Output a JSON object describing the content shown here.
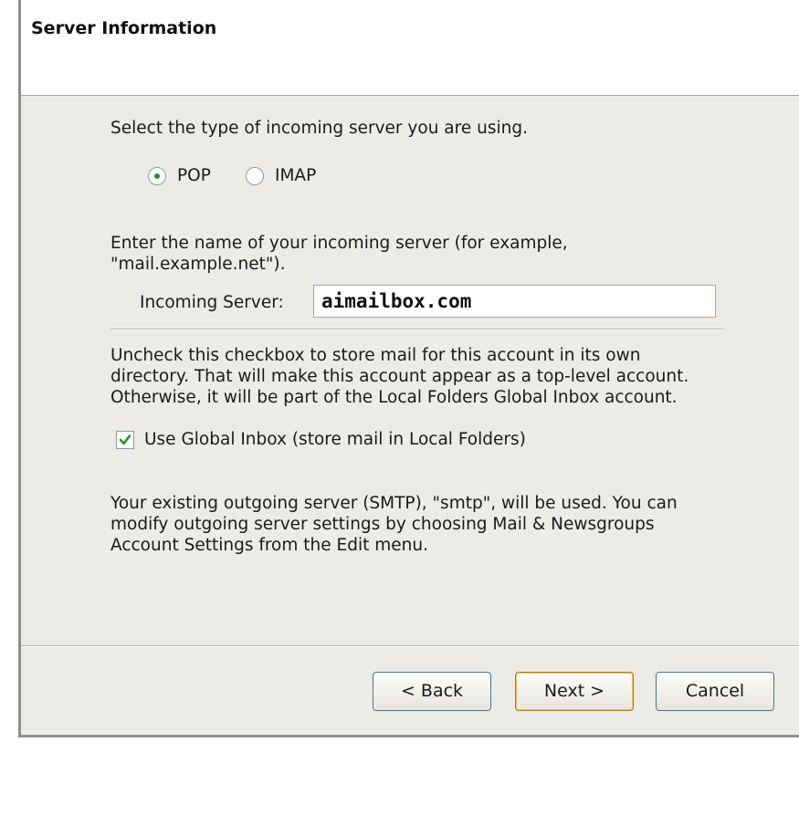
{
  "header": {
    "title": "Server Information"
  },
  "server_type": {
    "prompt": "Select the type of incoming server you are using.",
    "options": [
      {
        "label": "POP",
        "selected": true
      },
      {
        "label": "IMAP",
        "selected": false
      }
    ]
  },
  "incoming": {
    "prompt_line1": "Enter the name of your incoming server (for example,",
    "prompt_line2": "\"mail.example.net\").",
    "label": "Incoming Server:",
    "value": "aimailbox.com"
  },
  "global_inbox": {
    "line1": "Uncheck this checkbox to store mail for this account in its own",
    "line2": "directory. That will make this account appear as a top-level account.",
    "line3": "Otherwise, it will be part of the Local Folders Global Inbox account.",
    "checkbox_label": "Use Global Inbox (store mail in Local Folders)",
    "checked": true
  },
  "outgoing": {
    "line1": "Your existing outgoing server (SMTP), \"smtp\", will be used. You can",
    "line2": "modify outgoing server settings by choosing Mail & Newsgroups",
    "line3": "Account Settings from the Edit menu."
  },
  "buttons": {
    "back": "< Back",
    "next": "Next >",
    "cancel": "Cancel"
  },
  "colors": {
    "dialog_bg": "#ecebe6",
    "radio_dot": "#2f8a2f",
    "check_mark": "#2f8a2f",
    "default_button_border": "#a57a2a"
  }
}
